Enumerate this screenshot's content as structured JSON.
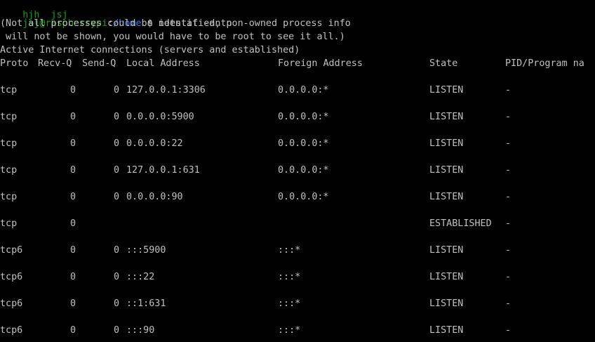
{
  "terminal": {
    "cut_top_line": "hjh  jsj",
    "prompt": {
      "user_host": "jsj@raspberrypi",
      "path": "/home",
      "symbol": "$",
      "command": "netstat -antp"
    },
    "notice_line1": "(Not all processes could be identified, non-owned process info",
    "notice_line2": " will not be shown, you would have to be root to see it all.)",
    "section_title": "Active Internet connections (servers and established)",
    "headers": {
      "proto": "Proto",
      "recvq": "Recv-Q",
      "sendq": "Send-Q",
      "local": "Local Address",
      "foreign": "Foreign Address",
      "state": "State",
      "pid": "PID/Program na"
    },
    "rows": [
      {
        "proto": "tcp",
        "recvq": "0",
        "sendq": "0",
        "local": "127.0.0.1:3306",
        "foreign": "0.0.0.0:*",
        "state": "LISTEN",
        "pid": "-"
      },
      {
        "proto": "tcp",
        "recvq": "0",
        "sendq": "0",
        "local": "0.0.0.0:5900",
        "foreign": "0.0.0.0:*",
        "state": "LISTEN",
        "pid": "-"
      },
      {
        "proto": "tcp",
        "recvq": "0",
        "sendq": "0",
        "local": "0.0.0.0:22",
        "foreign": "0.0.0.0:*",
        "state": "LISTEN",
        "pid": "-"
      },
      {
        "proto": "tcp",
        "recvq": "0",
        "sendq": "0",
        "local": "127.0.0.1:631",
        "foreign": "0.0.0.0:*",
        "state": "LISTEN",
        "pid": "-"
      },
      {
        "proto": "tcp",
        "recvq": "0",
        "sendq": "0",
        "local": "0.0.0.0:90",
        "foreign": "0.0.0.0:*",
        "state": "LISTEN",
        "pid": "-"
      },
      {
        "proto": "tcp",
        "recvq": "0",
        "sendq": "",
        "local": "",
        "foreign": "",
        "state": "ESTABLISHED",
        "pid": "-"
      },
      {
        "proto": "tcp6",
        "recvq": "0",
        "sendq": "0",
        "local": ":::5900",
        "foreign": ":::*",
        "state": "LISTEN",
        "pid": "-"
      },
      {
        "proto": "tcp6",
        "recvq": "0",
        "sendq": "0",
        "local": ":::22",
        "foreign": ":::*",
        "state": "LISTEN",
        "pid": "-"
      },
      {
        "proto": "tcp6",
        "recvq": "0",
        "sendq": "0",
        "local": "::1:631",
        "foreign": ":::*",
        "state": "LISTEN",
        "pid": "-"
      },
      {
        "proto": "tcp6",
        "recvq": "0",
        "sendq": "0",
        "local": ":::90",
        "foreign": ":::*",
        "state": "LISTEN",
        "pid": "-"
      }
    ]
  }
}
